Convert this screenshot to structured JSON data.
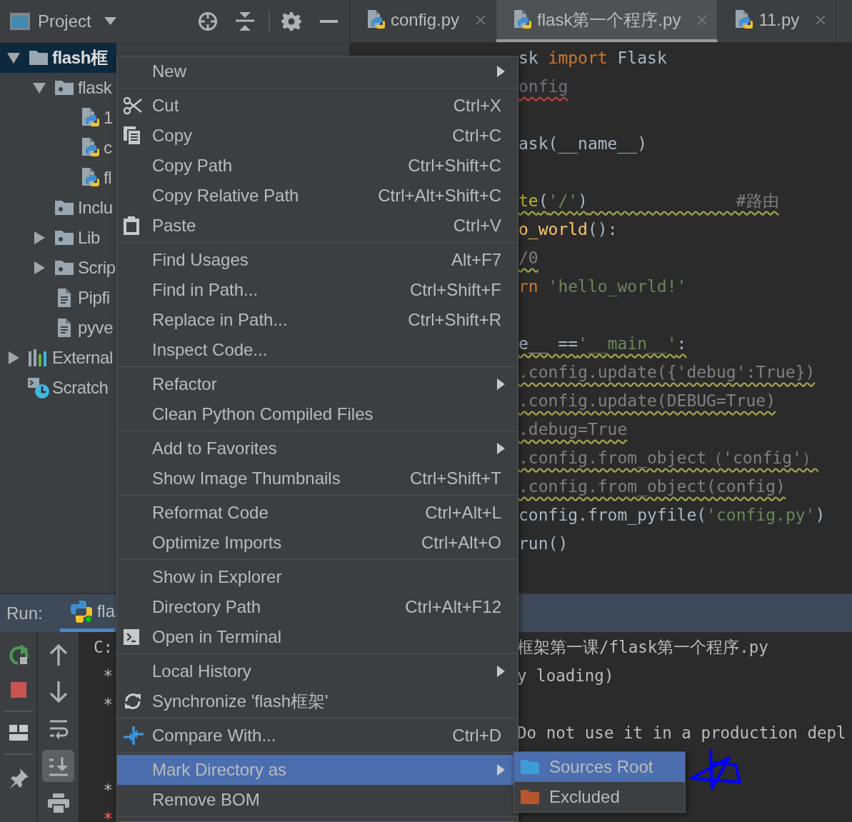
{
  "project_panel": {
    "title": "Project"
  },
  "editor_tabs": [
    {
      "label": "config.py",
      "selected": false
    },
    {
      "label": "flask第一个程序.py",
      "selected": true
    },
    {
      "label": "11.py",
      "selected": false
    }
  ],
  "project_tree": [
    {
      "label": "flash框",
      "kind": "root-folder",
      "expanded": true,
      "selected": true,
      "children": [
        {
          "label": "flask",
          "kind": "folder",
          "expanded": true,
          "selected": false,
          "children": [
            {
              "label": "1",
              "kind": "python-file",
              "selected": false
            },
            {
              "label": "c",
              "kind": "python-file",
              "selected": false
            },
            {
              "label": "fl",
              "kind": "python-file",
              "selected": false
            }
          ]
        },
        {
          "label": "Inclu",
          "kind": "folder",
          "selected": false
        },
        {
          "label": "Lib",
          "kind": "folder",
          "expanded": false,
          "selected": false
        },
        {
          "label": "Scrip",
          "kind": "folder",
          "expanded": false,
          "selected": false
        },
        {
          "label": "Pipfi",
          "kind": "text-file",
          "selected": false
        },
        {
          "label": "pyve",
          "kind": "text-file",
          "selected": false
        }
      ]
    },
    {
      "label": "External",
      "kind": "library",
      "expanded": false,
      "selected": false
    },
    {
      "label": "Scratch",
      "kind": "scratches",
      "selected": false
    }
  ],
  "code_blocks": [
    [
      {
        "tokens": [
          {
            "text": "sk",
            "kind": "plain"
          },
          {
            "text": " import",
            "kind": "keyword"
          },
          {
            "text": " Flask",
            "kind": "plain"
          }
        ],
        "warning": false
      },
      {
        "tokens": [
          {
            "text": "onfig",
            "kind": "unresolved"
          }
        ],
        "warning": false
      }
    ],
    [
      {
        "tokens": [
          {
            "text": "ask(__name__)",
            "kind": "plain"
          }
        ],
        "warning": false
      }
    ],
    [
      {
        "tokens": [
          {
            "text": "te",
            "kind": "decorator"
          },
          {
            "text": "(",
            "kind": "plain"
          },
          {
            "text": "'/'",
            "kind": "string"
          },
          {
            "text": ")",
            "kind": "plain"
          },
          {
            "text": "               #路由",
            "kind": "comment"
          }
        ],
        "warning": true
      },
      {
        "tokens": [
          {
            "text": "o_world",
            "kind": "function"
          },
          {
            "text": "():",
            "kind": "plain"
          }
        ],
        "warning": false
      },
      {
        "tokens": [
          {
            "text": "/0",
            "kind": "comment"
          }
        ],
        "warning": true
      },
      {
        "tokens": [
          {
            "text": "rn",
            "kind": "keyword"
          },
          {
            "text": " 'hello_world!'",
            "kind": "string"
          }
        ],
        "warning": false
      }
    ],
    [
      {
        "tokens": [
          {
            "text": "e__ ==",
            "kind": "plain"
          },
          {
            "text": "'__main__'",
            "kind": "string"
          },
          {
            "text": ":",
            "kind": "plain"
          }
        ],
        "warning": true
      },
      {
        "tokens": [
          {
            "text": ".config.update({'debug':True})",
            "kind": "comment"
          }
        ],
        "warning": true
      },
      {
        "tokens": [
          {
            "text": ".config.update(DEBUG=True)",
            "kind": "comment"
          }
        ],
        "warning": true
      },
      {
        "tokens": [
          {
            "text": ".debug=True",
            "kind": "comment"
          }
        ],
        "warning": true
      },
      {
        "tokens": [
          {
            "text": ".config.from_object（'config'）",
            "kind": "comment"
          }
        ],
        "warning": true
      },
      {
        "tokens": [
          {
            "text": ".config.from_object(config)",
            "kind": "comment"
          }
        ],
        "warning": true
      },
      {
        "tokens": [
          {
            "text": "config.from_pyfile(",
            "kind": "plain"
          },
          {
            "text": "'config.py'",
            "kind": "string"
          },
          {
            "text": ")",
            "kind": "plain"
          }
        ],
        "warning": false
      },
      {
        "tokens": [
          {
            "text": "run()",
            "kind": "plain"
          }
        ],
        "warning": false
      }
    ]
  ],
  "run": {
    "label": "Run:",
    "tab": {
      "label": "fla",
      "selected": true
    },
    "secondary_tools": [
      {
        "selected": false
      },
      {
        "selected": false
      },
      {
        "selected": false
      },
      {
        "selected": true
      },
      {
        "selected": false
      }
    ],
    "output_blocks": [
      [
        {
          "prefix": "C:",
          "text": "框架第一课/flask第一个程序.py",
          "stderr": false
        },
        {
          "prefix": "*",
          "text": "y loading)",
          "stderr": false
        },
        {
          "prefix": "*",
          "stderr": false
        },
        {
          "text": "Do not use it in a production depl"
        }
      ],
      [
        {
          "prefix": "*",
          "stderr": false
        },
        {
          "prefix": "*",
          "stderr": true
        }
      ]
    ]
  },
  "context_menu": {
    "sections": [
      [
        {
          "label": "New",
          "has_submenu": true,
          "selected": false
        }
      ],
      [
        {
          "label": "Cut",
          "shortcut": "Ctrl+X",
          "has_submenu": false,
          "selected": false
        },
        {
          "label": "Copy",
          "shortcut": "Ctrl+C",
          "has_submenu": false,
          "selected": false
        },
        {
          "label": "Copy Path",
          "shortcut": "Ctrl+Shift+C",
          "has_submenu": false,
          "selected": false
        },
        {
          "label": "Copy Relative Path",
          "shortcut": "Ctrl+Alt+Shift+C",
          "has_submenu": false,
          "selected": false
        },
        {
          "label": "Paste",
          "shortcut": "Ctrl+V",
          "has_submenu": false,
          "selected": false
        }
      ],
      [
        {
          "label": "Find Usages",
          "shortcut": "Alt+F7",
          "has_submenu": false,
          "selected": false
        },
        {
          "label": "Find in Path...",
          "shortcut": "Ctrl+Shift+F",
          "has_submenu": false,
          "selected": false
        },
        {
          "label": "Replace in Path...",
          "shortcut": "Ctrl+Shift+R",
          "has_submenu": false,
          "selected": false
        },
        {
          "label": "Inspect Code...",
          "has_submenu": false,
          "selected": false
        }
      ],
      [
        {
          "label": "Refactor",
          "has_submenu": true,
          "selected": false
        },
        {
          "label": "Clean Python Compiled Files",
          "has_submenu": false,
          "selected": false
        }
      ],
      [
        {
          "label": "Add to Favorites",
          "has_submenu": true,
          "selected": false
        },
        {
          "label": "Show Image Thumbnails",
          "shortcut": "Ctrl+Shift+T",
          "has_submenu": false,
          "selected": false
        }
      ],
      [
        {
          "label": "Reformat Code",
          "shortcut": "Ctrl+Alt+L",
          "has_submenu": false,
          "selected": false
        },
        {
          "label": "Optimize Imports",
          "shortcut": "Ctrl+Alt+O",
          "has_submenu": false,
          "selected": false
        }
      ],
      [
        {
          "label": "Show in Explorer",
          "has_submenu": false,
          "selected": false
        },
        {
          "label": "Directory Path",
          "shortcut": "Ctrl+Alt+F12",
          "has_submenu": false,
          "selected": false
        },
        {
          "label": "Open in Terminal",
          "has_submenu": false,
          "selected": false
        }
      ],
      [
        {
          "label": "Local History",
          "has_submenu": true,
          "selected": false
        },
        {
          "label": "Synchronize 'flash框架'",
          "has_submenu": false,
          "selected": false
        }
      ],
      [
        {
          "label": "Compare With...",
          "shortcut": "Ctrl+D",
          "has_submenu": false,
          "selected": false
        }
      ],
      [
        {
          "label": "Mark Directory as",
          "has_submenu": true,
          "selected": true
        },
        {
          "label": "Remove BOM",
          "has_submenu": false,
          "selected": false
        }
      ]
    ]
  },
  "submenu": {
    "items": [
      {
        "label": "Sources Root",
        "selected": true,
        "color": "#3d9bd6"
      },
      {
        "label": "Excluded",
        "selected": false,
        "color": "#b5562c"
      }
    ]
  }
}
